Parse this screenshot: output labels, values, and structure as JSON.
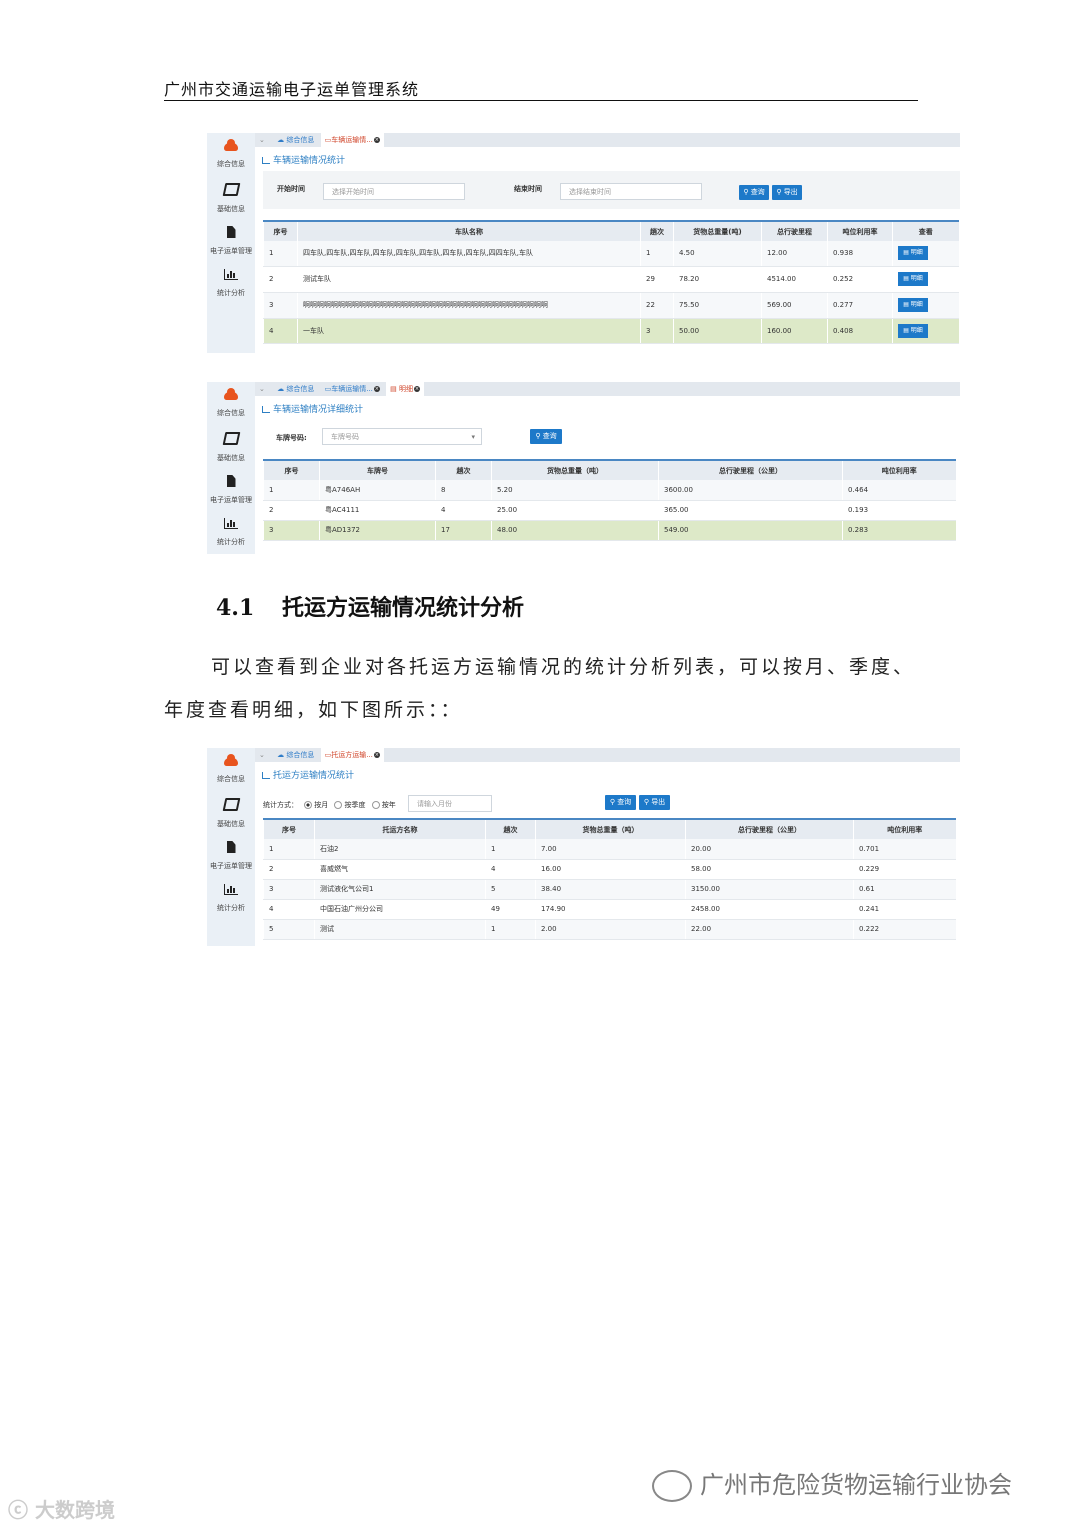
{
  "doc": {
    "header_title": "广州市交通运输电子运单管理系统",
    "section_number": "4.1",
    "section_title": "托运方运输情况统计分析",
    "paragraph": "可以查看到企业对各托运方运输情况的统计分析列表，可以按月、季度、年度查看明细，如下图所示：："
  },
  "sidebar": {
    "items": [
      {
        "label": "综合信息",
        "icon": "cloud-icon"
      },
      {
        "label": "基础信息",
        "icon": "book-icon"
      },
      {
        "label": "电子运单管理",
        "icon": "document-icon"
      },
      {
        "label": "统计分析",
        "icon": "bar-chart-icon"
      }
    ]
  },
  "panel1": {
    "tabs": [
      "综合信息",
      "车辆运输情..."
    ],
    "title": "车辆运输情况统计",
    "start_label": "开始时间",
    "start_placeholder": "选择开始时间",
    "end_label": "结束时间",
    "end_placeholder": "选择结束时间",
    "query_label": "查询",
    "export_label": "导出",
    "columns": [
      "序号",
      "车队名称",
      "趟次",
      "货物总重量(吨)",
      "总行驶里程",
      "吨位利用率",
      "查看"
    ],
    "detail_label": "明细",
    "rows": [
      [
        "1",
        "四车队,四车队,四车队,四车队,四车队,四车队,四车队,四车队,四四车队,车队",
        "1",
        "4.50",
        "12.00",
        "0.938"
      ],
      [
        "2",
        "测试车队",
        "29",
        "78.20",
        "4514.00",
        "0.252"
      ],
      [
        "3",
        "啊啊啊啊啊啊啊啊啊啊啊啊啊啊啊啊啊啊啊啊啊啊啊啊啊啊啊啊啊啊啊啊啊啊啊",
        "22",
        "75.50",
        "569.00",
        "0.277"
      ],
      [
        "4",
        "一车队",
        "3",
        "50.00",
        "160.00",
        "0.408"
      ]
    ]
  },
  "panel2": {
    "tabs": [
      "综合信息",
      "车辆运输情...",
      "明细"
    ],
    "title": "车辆运输情况详细统计",
    "plate_label": "车牌号码:",
    "plate_placeholder": "车牌号码",
    "query_label": "查询",
    "columns": [
      "序号",
      "车牌号",
      "趟次",
      "货物总重量（吨）",
      "总行驶里程（公里）",
      "吨位利用率"
    ],
    "rows": [
      [
        "1",
        "粤A746AH",
        "8",
        "5.20",
        "3600.00",
        "0.464"
      ],
      [
        "2",
        "粤AC4111",
        "4",
        "25.00",
        "365.00",
        "0.193"
      ],
      [
        "3",
        "粤AD1372",
        "17",
        "48.00",
        "549.00",
        "0.283"
      ]
    ]
  },
  "panel3": {
    "tabs": [
      "综合信息",
      "托运方运输..."
    ],
    "title": "托运方运输情况统计",
    "mode_label": "统计方式：",
    "options": [
      "按月",
      "按季度",
      "按年"
    ],
    "month_placeholder": "请输入月份",
    "query_label": "查询",
    "export_label": "导出",
    "columns": [
      "序号",
      "托运方名称",
      "趟次",
      "货物总重量（吨）",
      "总行驶里程（公里）",
      "吨位利用率"
    ],
    "rows": [
      [
        "1",
        "石油2",
        "1",
        "7.00",
        "20.00",
        "0.701"
      ],
      [
        "2",
        "喜威燃气",
        "4",
        "16.00",
        "58.00",
        "0.229"
      ],
      [
        "3",
        "测试液化气公司1",
        "5",
        "38.40",
        "3150.00",
        "0.61"
      ],
      [
        "4",
        "中国石油广州分公司",
        "49",
        "174.90",
        "2458.00",
        "0.241"
      ],
      [
        "5",
        "测试",
        "1",
        "2.00",
        "22.00",
        "0.222"
      ]
    ]
  },
  "watermarks": {
    "left": "大数跨境",
    "right": "广州市危险货物运输行业协会"
  }
}
